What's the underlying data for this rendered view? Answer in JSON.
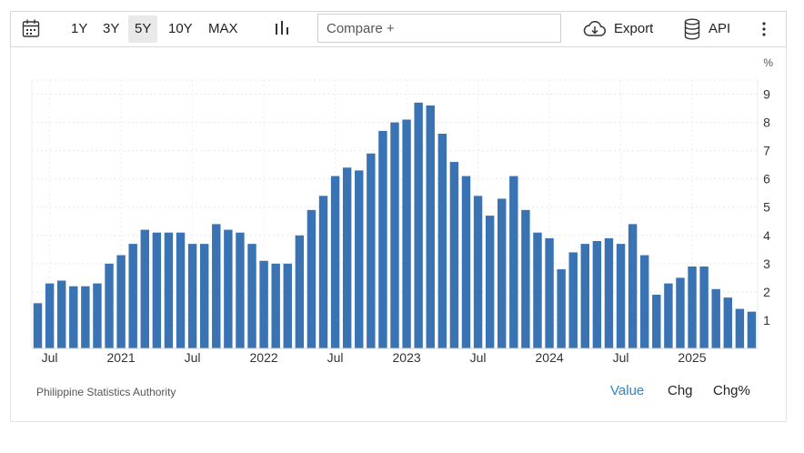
{
  "toolbar": {
    "ranges": [
      "1Y",
      "3Y",
      "5Y",
      "10Y",
      "MAX"
    ],
    "active_range": "5Y",
    "compare_placeholder": "Compare +",
    "export_label": "Export",
    "api_label": "API",
    "icons": [
      "calendar-icon",
      "bar-chart-icon",
      "cloud-download-icon",
      "database-icon",
      "more-vertical-icon"
    ]
  },
  "chart_data": {
    "type": "bar",
    "unit": "%",
    "bar_color": "#3a73b3",
    "ylim": [
      0,
      9.5
    ],
    "y_ticks": [
      1,
      2,
      3,
      4,
      5,
      6,
      7,
      8,
      9
    ],
    "y_axis_position": "right",
    "grid": true,
    "x_tick_labels": [
      {
        "label": "Jul",
        "index": 1
      },
      {
        "label": "2021",
        "index": 7
      },
      {
        "label": "Jul",
        "index": 13
      },
      {
        "label": "2022",
        "index": 19
      },
      {
        "label": "Jul",
        "index": 25
      },
      {
        "label": "2023",
        "index": 31
      },
      {
        "label": "Jul",
        "index": 37
      },
      {
        "label": "2024",
        "index": 43
      },
      {
        "label": "Jul",
        "index": 49
      },
      {
        "label": "2025",
        "index": 55
      }
    ],
    "values": [
      1.6,
      2.3,
      2.4,
      2.2,
      2.2,
      2.3,
      3.0,
      3.3,
      3.7,
      4.2,
      4.1,
      4.1,
      4.1,
      3.7,
      3.7,
      4.4,
      4.2,
      4.1,
      3.7,
      3.1,
      3.0,
      3.0,
      4.0,
      4.9,
      5.4,
      6.1,
      6.4,
      6.3,
      6.9,
      7.7,
      8.0,
      8.1,
      8.7,
      8.6,
      7.6,
      6.6,
      6.1,
      5.4,
      4.7,
      5.3,
      6.1,
      4.9,
      4.1,
      3.9,
      2.8,
      3.4,
      3.7,
      3.8,
      3.9,
      3.7,
      4.4,
      3.3,
      1.9,
      2.3,
      2.5,
      2.9,
      2.9,
      2.1,
      1.8,
      1.4,
      1.3
    ]
  },
  "footer": {
    "source": "Philippine Statistics Authority",
    "tabs": [
      "Value",
      "Chg",
      "Chg%"
    ],
    "active_tab": "Value"
  }
}
